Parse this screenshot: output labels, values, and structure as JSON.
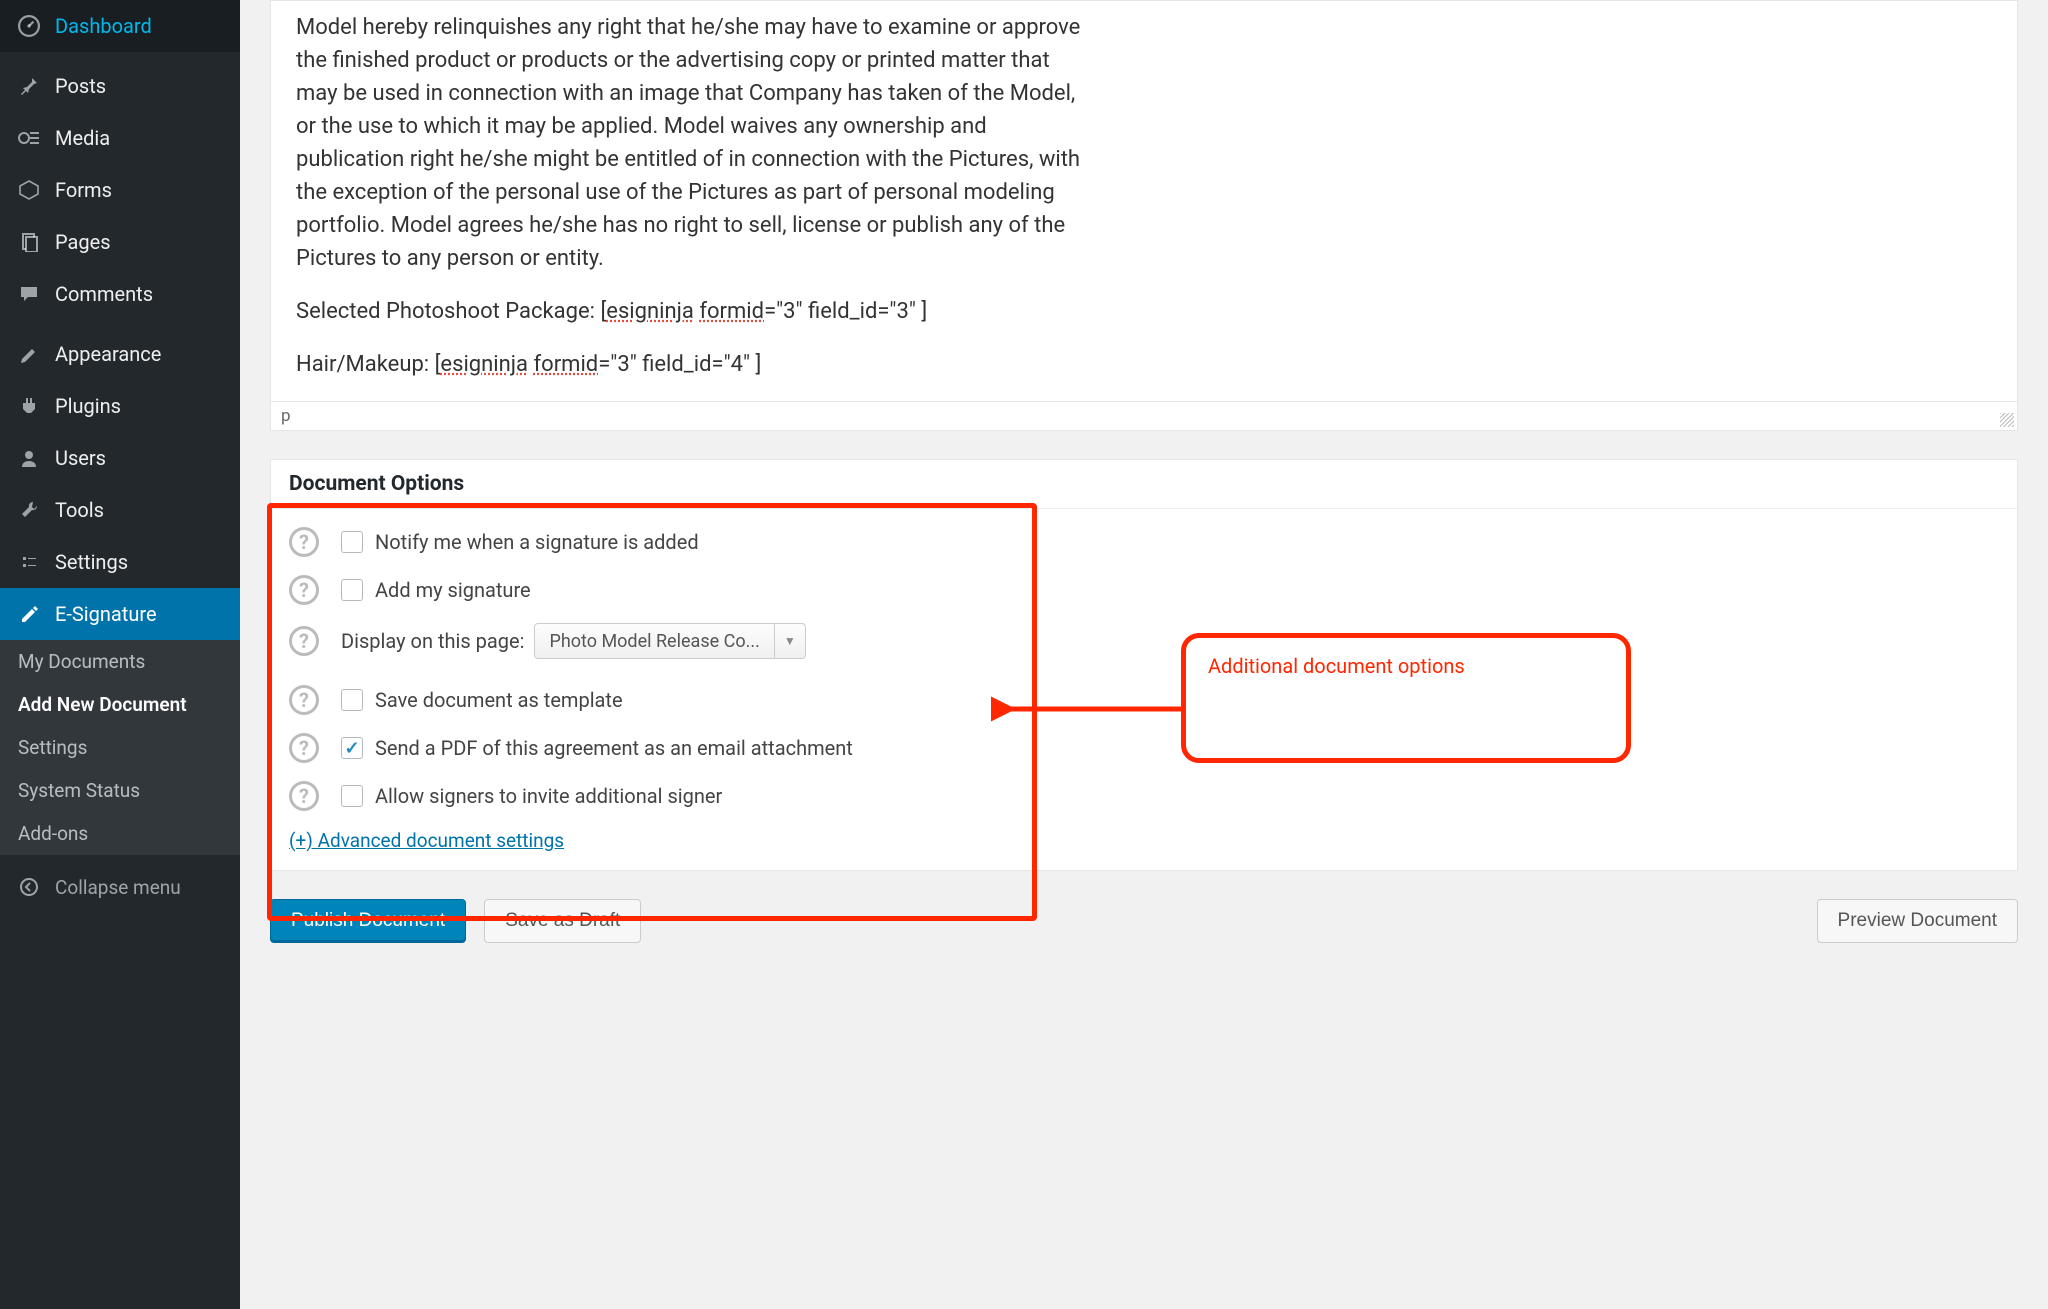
{
  "sidebar": {
    "items": [
      {
        "label": "Dashboard",
        "icon": "dashboard"
      },
      {
        "label": "Posts",
        "icon": "pin"
      },
      {
        "label": "Media",
        "icon": "media"
      },
      {
        "label": "Forms",
        "icon": "forms"
      },
      {
        "label": "Pages",
        "icon": "pages"
      },
      {
        "label": "Comments",
        "icon": "comments"
      },
      {
        "label": "Appearance",
        "icon": "appearance"
      },
      {
        "label": "Plugins",
        "icon": "plugins"
      },
      {
        "label": "Users",
        "icon": "users"
      },
      {
        "label": "Tools",
        "icon": "tools"
      },
      {
        "label": "Settings",
        "icon": "settings"
      },
      {
        "label": "E-Signature",
        "icon": "esignature"
      }
    ],
    "submenu": [
      "My Documents",
      "Add New Document",
      "Settings",
      "System Status",
      "Add-ons"
    ],
    "collapse": "Collapse menu"
  },
  "editor": {
    "body_p1": "Model hereby relinquishes any right that he/she may have to examine or approve the finished product or products or the advertising copy or printed matter that may be used in connection with an image that Company has taken of the Model, or the use to which it may be applied. Model waives any ownership and publication right he/she might be entitled of in connection with the Pictures, with the exception of the personal use of the Pictures as part of personal modeling portfolio. Model agrees he/she has no right to sell, license or publish any of the Pictures to any person or entity.",
    "body_p2_prefix": "Selected Photoshoot Package: [",
    "body_p2_sc1": "esigninja",
    "body_p2_mid": " ",
    "body_p2_sc2": "formid",
    "body_p2_suffix": "=\"3\" field_id=\"3\" ]",
    "body_p3_prefix": "Hair/Makeup:  [",
    "body_p3_sc1": "esigninja",
    "body_p3_mid": " ",
    "body_p3_sc2": "formid",
    "body_p3_suffix": "=\"3\" field_id=\"4\" ]",
    "path": "p"
  },
  "doc_options": {
    "title": "Document Options",
    "opt_notify": "Notify me when a signature is added",
    "opt_addsig": "Add my signature",
    "display_label": "Display on this page:",
    "display_value": "Photo Model Release Co...",
    "opt_save_tpl": "Save document as template",
    "opt_send_pdf": "Send a PDF of this agreement as an email attachment",
    "opt_allow_invite": "Allow signers to invite additional signer",
    "advanced": "(+) Advanced document settings"
  },
  "annotation": {
    "label": "Additional document options"
  },
  "buttons": {
    "publish": "Publish Document",
    "draft": "Save as Draft",
    "preview": "Preview Document"
  }
}
